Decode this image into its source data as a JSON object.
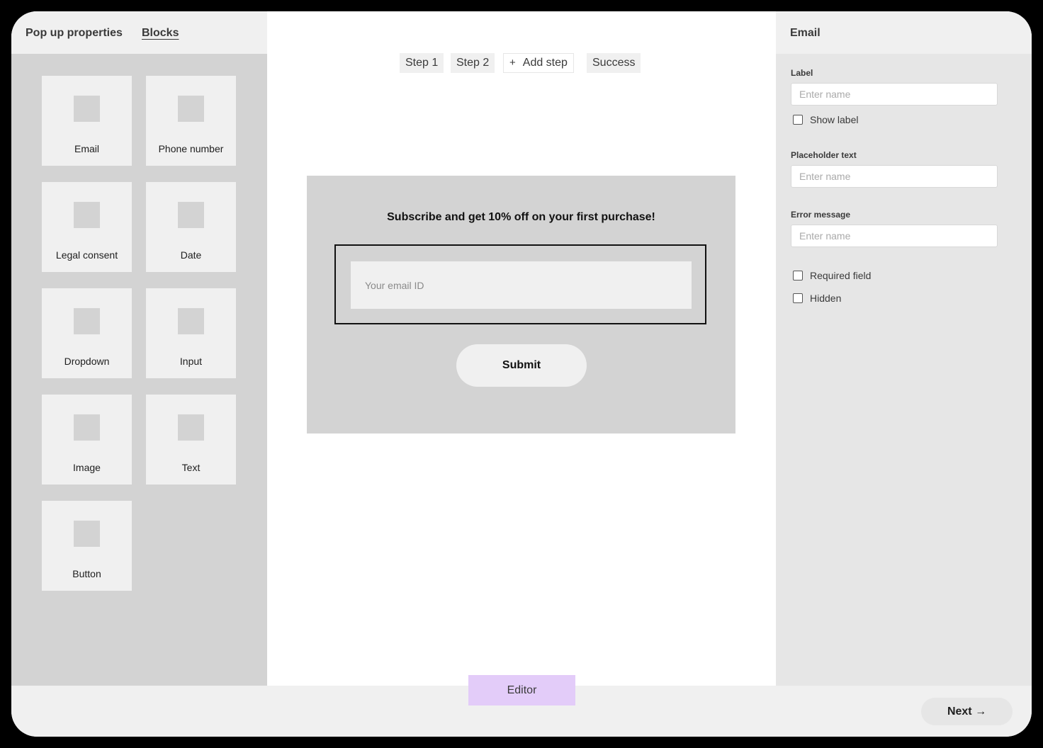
{
  "left_panel": {
    "tabs": [
      {
        "label": "Pop up properties"
      },
      {
        "label": "Blocks"
      }
    ],
    "blocks": [
      {
        "label": "Email"
      },
      {
        "label": "Phone number"
      },
      {
        "label": "Legal consent"
      },
      {
        "label": "Date"
      },
      {
        "label": "Dropdown"
      },
      {
        "label": "Input"
      },
      {
        "label": "Image"
      },
      {
        "label": "Text"
      },
      {
        "label": "Button"
      }
    ]
  },
  "steps": {
    "items": [
      {
        "label": "Step 1"
      },
      {
        "label": "Step 2"
      },
      {
        "label": "Add step",
        "icon": "+"
      },
      {
        "label": "Success"
      }
    ]
  },
  "popup": {
    "title": "Subscribe and get 10% off on your first purchase!",
    "email_placeholder": "Your email ID",
    "submit_label": "Submit"
  },
  "right_panel": {
    "title": "Email",
    "label_field": {
      "label": "Label",
      "placeholder": "Enter name"
    },
    "show_label": "Show label",
    "placeholder_field": {
      "label": "Placeholder text",
      "placeholder": "Enter name"
    },
    "error_field": {
      "label": "Error message",
      "placeholder": "Enter name"
    },
    "required_field": "Required field",
    "hidden": "Hidden"
  },
  "bottom_bar": {
    "editor_label": "Editor",
    "next_label": "Next →"
  }
}
